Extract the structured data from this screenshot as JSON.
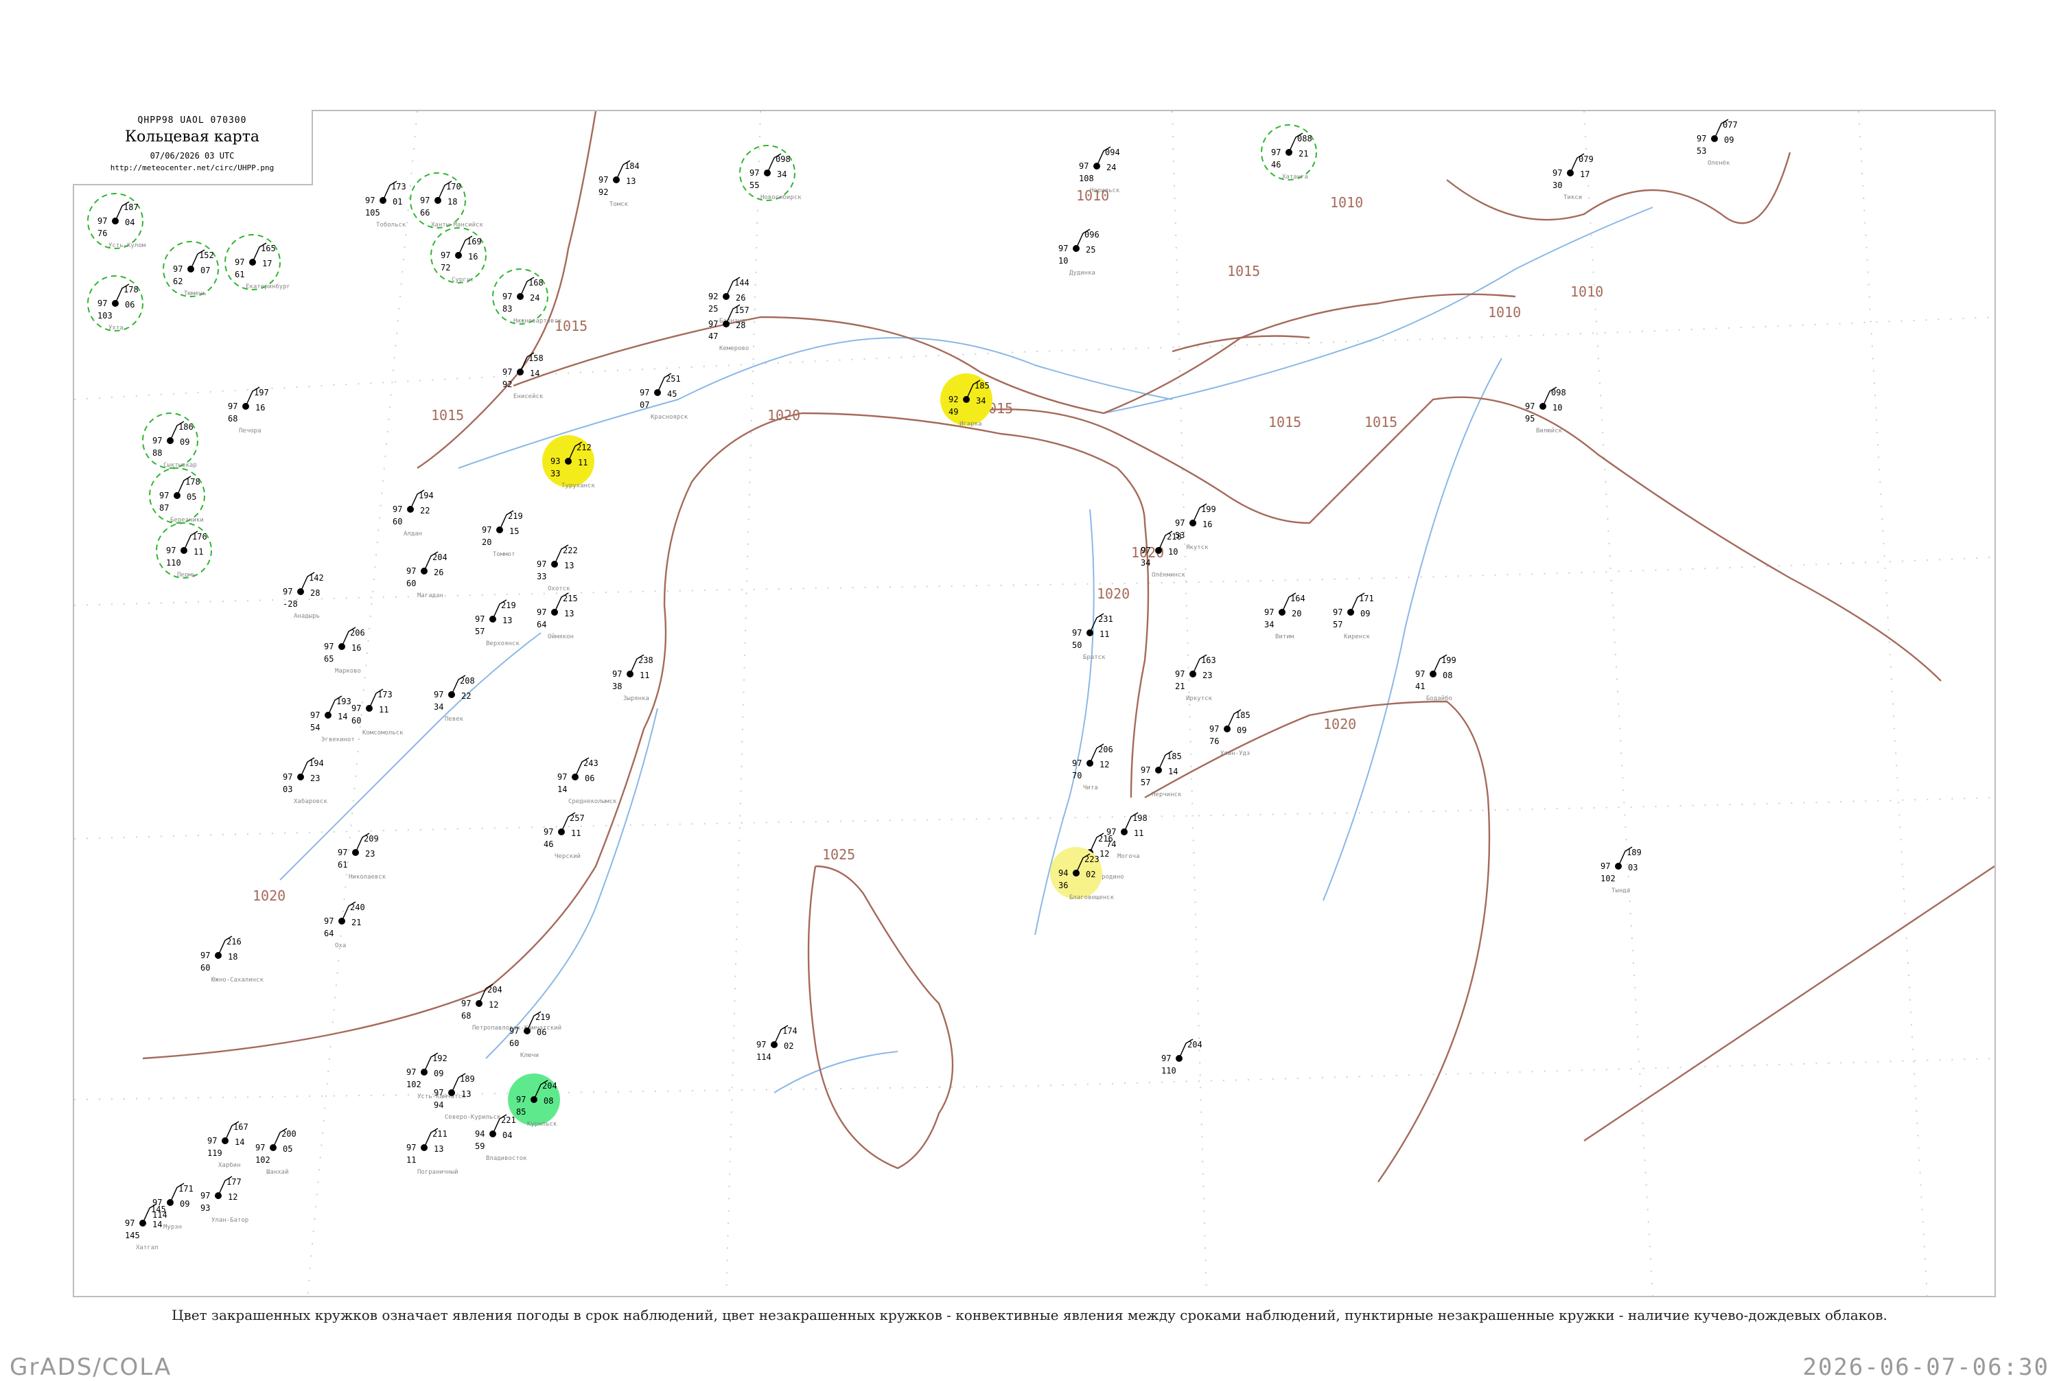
{
  "header": {
    "code": "QHPP98  UAOL  070300",
    "title": "Кольцевая карта",
    "datetime": "07/06/2026 03 UTC",
    "url": "http://meteocenter.net/circ/UHPP.png"
  },
  "legend": "Цвет закрашенных кружков означает явления погоды в срок наблюдений, цвет незакрашенных кружков - конвективные явления между сроками наблюдений, пунктирные незакрашенные кружки - наличие кучево-дождевых облаков.",
  "footer": {
    "software": "GrADS/COLA",
    "timestamp": "2026-06-07-06:30"
  },
  "colors": {
    "isobar": "#a56a5a",
    "river": "#8ab8e6",
    "cb_dashed": "#2fb52f",
    "green_fill": "#0fbf24",
    "yellow_fill": "#f4ec1a",
    "light_green_fill": "#5eea8c",
    "light_yellow_fill": "#f7f28a",
    "grid": "#bbbbbb"
  },
  "isobars": [
    "1010",
    "1010",
    "1010",
    "1010",
    "1015",
    "1015",
    "1015",
    "1015",
    "1015",
    "1015",
    "1020",
    "1020",
    "1020",
    "1020",
    "1020",
    "1025"
  ],
  "stations": [
    {
      "top": "187",
      "mid": "97",
      "right": "04",
      "bottom": "76"
    },
    {
      "top": "178",
      "mid": "97",
      "right": "06",
      "bottom": "103"
    },
    {
      "top": "197",
      "mid": "97",
      "right": "16",
      "bottom": "68"
    },
    {
      "top": "186",
      "mid": "97",
      "right": "09",
      "bottom": "88"
    },
    {
      "top": "178",
      "mid": "97",
      "right": "05",
      "bottom": "87"
    },
    {
      "top": "176",
      "mid": "97",
      "right": "11",
      "bottom": "110"
    },
    {
      "top": "165",
      "mid": "97",
      "right": "17",
      "bottom": "61"
    },
    {
      "top": "152",
      "mid": "97",
      "right": "07",
      "bottom": "62"
    },
    {
      "top": "173",
      "mid": "97",
      "right": "01",
      "bottom": "105"
    },
    {
      "top": "170",
      "mid": "97",
      "right": "18",
      "bottom": "66"
    },
    {
      "top": "169",
      "mid": "97",
      "right": "16",
      "bottom": "72"
    },
    {
      "top": "168",
      "mid": "97",
      "right": "24",
      "bottom": "83"
    },
    {
      "top": "184",
      "mid": "97",
      "right": "13",
      "bottom": "92"
    },
    {
      "top": "098",
      "mid": "97",
      "right": "34",
      "bottom": "55"
    },
    {
      "top": "144",
      "mid": "92",
      "right": "26",
      "bottom": "25"
    },
    {
      "top": "157",
      "mid": "97",
      "right": "28",
      "bottom": "47"
    },
    {
      "top": "251",
      "mid": "97",
      "right": "45",
      "bottom": "07"
    },
    {
      "top": "158",
      "mid": "97",
      "right": "14",
      "bottom": "92"
    },
    {
      "top": "212",
      "mid": "93",
      "right": "11",
      "bottom": "33"
    },
    {
      "top": "185",
      "mid": "92",
      "right": "34",
      "bottom": "49"
    },
    {
      "top": "094",
      "mid": "97",
      "right": "24",
      "bottom": "108"
    },
    {
      "top": "096",
      "mid": "97",
      "right": "25",
      "bottom": "10"
    },
    {
      "top": "088",
      "mid": "97",
      "right": "21",
      "bottom": "46"
    },
    {
      "top": "079",
      "mid": "97",
      "right": "17",
      "bottom": "30"
    },
    {
      "top": "077",
      "mid": "97",
      "right": "09",
      "bottom": "53"
    },
    {
      "top": "098",
      "mid": "97",
      "right": "10",
      "bottom": "95"
    },
    {
      "top": "199",
      "mid": "97",
      "right": "16",
      "bottom": "53"
    },
    {
      "top": "218",
      "mid": "97",
      "right": "10",
      "bottom": "34"
    },
    {
      "top": "164",
      "mid": "97",
      "right": "20",
      "bottom": "34"
    },
    {
      "top": "171",
      "mid": "97",
      "right": "09",
      "bottom": "57"
    },
    {
      "top": "199",
      "mid": "97",
      "right": "08",
      "bottom": "41"
    },
    {
      "top": "231",
      "mid": "97",
      "right": "11",
      "bottom": "50"
    },
    {
      "top": "163",
      "mid": "97",
      "right": "23",
      "bottom": "21"
    },
    {
      "top": "185",
      "mid": "97",
      "right": "09",
      "bottom": "76"
    },
    {
      "top": "206",
      "mid": "97",
      "right": "12",
      "bottom": "70"
    },
    {
      "top": "185",
      "mid": "97",
      "right": "14",
      "bottom": "57"
    },
    {
      "top": "198",
      "mid": "97",
      "right": "11",
      "bottom": "74"
    },
    {
      "top": "216",
      "mid": "97",
      "right": "12",
      "bottom": "31"
    },
    {
      "top": "223",
      "mid": "94",
      "right": "02",
      "bottom": "36"
    },
    {
      "top": "189",
      "mid": "97",
      "right": "03",
      "bottom": "102"
    },
    {
      "top": "194",
      "mid": "97",
      "right": "22",
      "bottom": "60"
    },
    {
      "top": "219",
      "mid": "97",
      "right": "15",
      "bottom": "20"
    },
    {
      "top": "222",
      "mid": "97",
      "right": "13",
      "bottom": "33"
    },
    {
      "top": "204",
      "mid": "97",
      "right": "26",
      "bottom": "60"
    },
    {
      "top": "215",
      "mid": "97",
      "right": "13",
      "bottom": "64"
    },
    {
      "top": "219",
      "mid": "97",
      "right": "13",
      "bottom": "57"
    },
    {
      "top": "238",
      "mid": "97",
      "right": "11",
      "bottom": "38"
    },
    {
      "top": "243",
      "mid": "97",
      "right": "06",
      "bottom": "14"
    },
    {
      "top": "257",
      "mid": "97",
      "right": "11",
      "bottom": "46"
    },
    {
      "top": "208",
      "mid": "97",
      "right": "22",
      "bottom": "34"
    },
    {
      "top": "142",
      "mid": "97",
      "right": "28",
      "bottom": "-28"
    },
    {
      "top": "206",
      "mid": "97",
      "right": "16",
      "bottom": "65"
    },
    {
      "top": "193",
      "mid": "97",
      "right": "14",
      "bottom": "54"
    },
    {
      "top": "194",
      "mid": "97",
      "right": "23",
      "bottom": "03"
    },
    {
      "top": "173",
      "mid": "97",
      "right": "11",
      "bottom": "60"
    },
    {
      "top": "209",
      "mid": "97",
      "right": "23",
      "bottom": "61"
    },
    {
      "top": "240",
      "mid": "97",
      "right": "21",
      "bottom": "64"
    },
    {
      "top": "216",
      "mid": "97",
      "right": "18",
      "bottom": "60"
    },
    {
      "top": "204",
      "mid": "97",
      "right": "12",
      "bottom": "68"
    },
    {
      "top": "219",
      "mid": "97",
      "right": "06",
      "bottom": "60"
    },
    {
      "top": "192",
      "mid": "97",
      "right": "09",
      "bottom": "102"
    },
    {
      "top": "189",
      "mid": "97",
      "right": "13",
      "bottom": "94"
    },
    {
      "top": "204",
      "mid": "97",
      "right": "08",
      "bottom": "85"
    },
    {
      "top": "221",
      "mid": "94",
      "right": "04",
      "bottom": "59"
    },
    {
      "top": "211",
      "mid": "97",
      "right": "13",
      "bottom": "11"
    },
    {
      "top": "200",
      "mid": "97",
      "right": "05",
      "bottom": "102"
    },
    {
      "top": "167",
      "mid": "97",
      "right": "14",
      "bottom": "119"
    },
    {
      "top": "177",
      "mid": "97",
      "right": "12",
      "bottom": "93"
    },
    {
      "top": "145",
      "mid": "97",
      "right": "14",
      "bottom": "145"
    },
    {
      "top": "171",
      "mid": "97",
      "right": "09",
      "bottom": "114"
    },
    {
      "top": "204",
      "mid": "97",
      "right": "",
      "bottom": "110"
    },
    {
      "top": "174",
      "mid": "97",
      "right": "02",
      "bottom": "114"
    }
  ],
  "cities": [
    "Усть-Кулом",
    "Ухта",
    "Печора",
    "Сыктывкар",
    "Березники",
    "Пермь",
    "Екатеринбург",
    "Тюмень",
    "Тобольск",
    "Ханты-Мансийск",
    "Сургут",
    "Нижневартовск",
    "Томск",
    "Новосибирск",
    "Барнаул",
    "Кемерово",
    "Красноярск",
    "Енисейск",
    "Туруханск",
    "Игарка",
    "Норильск",
    "Дудинка",
    "Хатанга",
    "Тикси",
    "Оленёк",
    "Вилюйск",
    "Якутск",
    "Олёкминск",
    "Витим",
    "Киренск",
    "Бодайбо",
    "Братск",
    "Иркутск",
    "Улан-Удэ",
    "Чита",
    "Нерчинск",
    "Могоча",
    "Сковородино",
    "Благовещенск",
    "Тында",
    "Алдан",
    "Томмот",
    "Охотск",
    "Магадан",
    "Оймякон",
    "Верхоянск",
    "Зырянка",
    "Среднеколымск",
    "Черский",
    "Певек",
    "Анадырь",
    "Марково",
    "Эгвекинот",
    "Хабаровск",
    "Комсомольск",
    "Николаевск",
    "Оха",
    "Южно-Сахалинск",
    "Петропавловск-Камчатский",
    "Ключи",
    "Усть-Камчатск",
    "Северо-Курильск",
    "Курильск",
    "Владивосток",
    "Пограничный",
    "Шанхай",
    "Харбин",
    "Улан-Батор",
    "Хатгал",
    "Мурэн"
  ]
}
